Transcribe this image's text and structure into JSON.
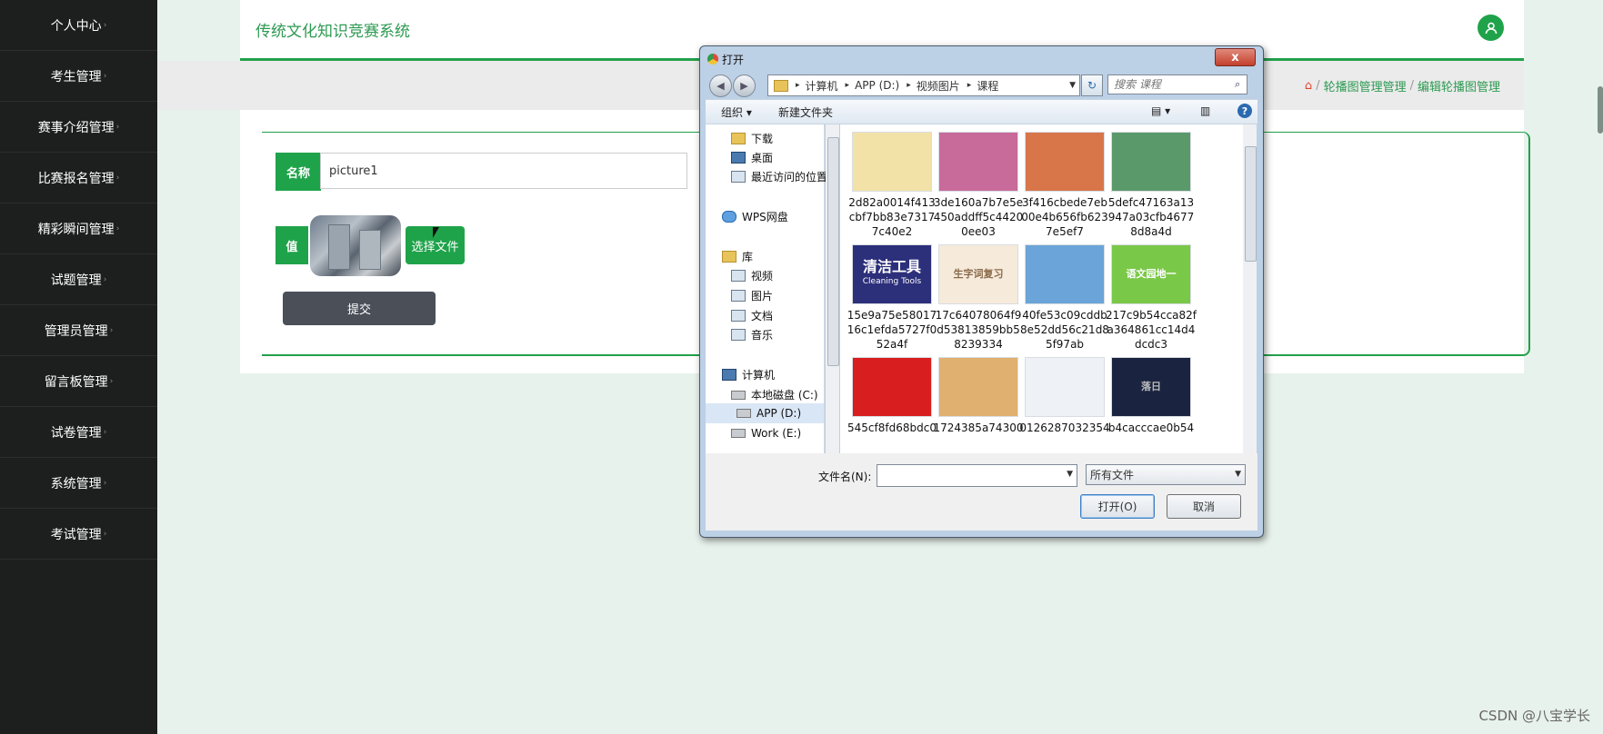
{
  "sidebar": {
    "items": [
      {
        "label": "个人中心"
      },
      {
        "label": "考生管理"
      },
      {
        "label": "赛事介绍管理"
      },
      {
        "label": "比赛报名管理"
      },
      {
        "label": "精彩瞬间管理"
      },
      {
        "label": "试题管理"
      },
      {
        "label": "管理员管理"
      },
      {
        "label": "留言板管理"
      },
      {
        "label": "试卷管理"
      },
      {
        "label": "系统管理"
      },
      {
        "label": "考试管理"
      }
    ]
  },
  "header": {
    "title": "传统文化知识竞赛系统"
  },
  "breadcrumb": {
    "home_icon": "home-icon",
    "sep": "/",
    "item1": "轮播图管理管理",
    "item2": "编辑轮播图管理"
  },
  "form": {
    "name_label": "名称",
    "name_value": "picture1",
    "value_label": "值",
    "choose_file": "选择文件",
    "submit": "提交"
  },
  "dialog": {
    "title": "打开",
    "close": "x",
    "path": [
      "计算机",
      "APP (D:)",
      "视频图片",
      "课程"
    ],
    "search_placeholder": "搜索 课程",
    "toolbar": {
      "organize": "组织 ▾",
      "new_folder": "新建文件夹"
    },
    "tree": [
      "下载",
      "桌面",
      "最近访问的位置",
      "WPS网盘",
      "库",
      "视频",
      "图片",
      "文档",
      "音乐",
      "计算机",
      "本地磁盘 (C:)",
      "APP (D:)",
      "Work (E:)"
    ],
    "files": [
      {
        "name": "2d82a0014f413cbf7bb83e73177c40e2",
        "l1": "2d82a0014f413",
        "l2": "cbf7bb83e7317",
        "l3": "7c40e2",
        "color": "#f3e2a8"
      },
      {
        "name": "3de160a7b7e5e450addff5c44200ee03",
        "l1": "3de160a7b7e5e",
        "l2": "450addff5c4420",
        "l3": "0ee03",
        "color": "#c86a9a"
      },
      {
        "name": "3f416cbede7eb00e4b656fb6237e5ef7",
        "l1": "3f416cbede7eb",
        "l2": "00e4b656fb623",
        "l3": "7e5ef7",
        "color": "#d8764a"
      },
      {
        "name": "5defc47163a13947a03cfb46778d8a4d",
        "l1": "5defc47163a13",
        "l2": "947a03cfb4677",
        "l3": "8d8a4d",
        "color": "#5a9a6a"
      },
      {
        "name": "15e9a75e5801716c1efda5727f052a4f",
        "l1": "15e9a75e58017",
        "l2": "16c1efda5727f0",
        "l3": "52a4f",
        "color": "#2c2f7a",
        "text": "清洁工具",
        "text2": "Cleaning Tools"
      },
      {
        "name": "17c64078064f9d53813859bb58239334",
        "l1": "17c64078064f9",
        "l2": "d53813859bb5",
        "l3": "8239334",
        "color": "#f6eadb",
        "text": "生字词复习"
      },
      {
        "name": "40fe53c09cddb8e52dd56c21d85f97ab",
        "l1": "40fe53c09cddb",
        "l2": "8e52dd56c21d8",
        "l3": "5f97ab",
        "color": "#6aa4d8"
      },
      {
        "name": "217c9b54cca82fa364861cc14d4dcdc3",
        "l1": "217c9b54cca82f",
        "l2": "a364861cc14d4",
        "l3": "dcdc3",
        "color": "#7ac848",
        "text": "语文园地一"
      },
      {
        "name": "545cf8fd68bdc0",
        "l1": "545cf8fd68bdc0",
        "l2": "",
        "l3": "",
        "color": "#d81e1e"
      },
      {
        "name": "1724385a74300",
        "l1": "1724385a74300",
        "l2": "",
        "l3": "",
        "color": "#e0b070"
      },
      {
        "name": "0126287032354",
        "l1": "0126287032354",
        "l2": "",
        "l3": "",
        "color": "#eef2f6"
      },
      {
        "name": "b4cacccae0b54",
        "l1": "b4cacccae0b54",
        "l2": "",
        "l3": "",
        "color": "#1a2440",
        "text": "落日"
      }
    ],
    "filename_label": "文件名(N):",
    "filename_value": "",
    "filetype": "所有文件",
    "open_button": "打开(O)",
    "cancel_button": "取消"
  },
  "watermark": "CSDN @八宝学长",
  "colors": {
    "accent": "#1fa34a",
    "sidebar_bg": "#1d1f1f",
    "page_bg": "#e8f2ec"
  }
}
